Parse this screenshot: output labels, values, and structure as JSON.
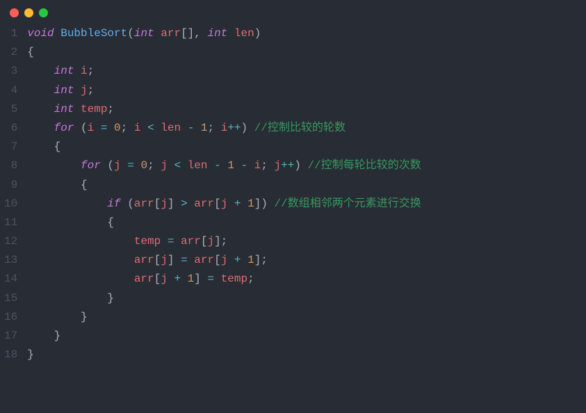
{
  "window": {
    "controls": [
      "red",
      "yellow",
      "green"
    ]
  },
  "code": {
    "line_count": 18,
    "lines": [
      {
        "n": 1,
        "indent": 0,
        "tokens": [
          {
            "t": "void ",
            "c": "type"
          },
          {
            "t": "BubbleSort",
            "c": "fn"
          },
          {
            "t": "(",
            "c": "punc"
          },
          {
            "t": "int ",
            "c": "type"
          },
          {
            "t": "arr",
            "c": "var"
          },
          {
            "t": "[], ",
            "c": "punc"
          },
          {
            "t": "int ",
            "c": "type"
          },
          {
            "t": "len",
            "c": "var"
          },
          {
            "t": ")",
            "c": "punc"
          }
        ]
      },
      {
        "n": 2,
        "indent": 0,
        "tokens": [
          {
            "t": "{",
            "c": "punc"
          }
        ]
      },
      {
        "n": 3,
        "indent": 1,
        "tokens": [
          {
            "t": "int ",
            "c": "type"
          },
          {
            "t": "i",
            "c": "var"
          },
          {
            "t": ";",
            "c": "punc"
          }
        ]
      },
      {
        "n": 4,
        "indent": 1,
        "tokens": [
          {
            "t": "int ",
            "c": "type"
          },
          {
            "t": "j",
            "c": "var"
          },
          {
            "t": ";",
            "c": "punc"
          }
        ]
      },
      {
        "n": 5,
        "indent": 1,
        "tokens": [
          {
            "t": "int ",
            "c": "type"
          },
          {
            "t": "temp",
            "c": "var"
          },
          {
            "t": ";",
            "c": "punc"
          }
        ]
      },
      {
        "n": 6,
        "indent": 1,
        "tokens": [
          {
            "t": "for ",
            "c": "kw"
          },
          {
            "t": "(",
            "c": "punc"
          },
          {
            "t": "i",
            "c": "var"
          },
          {
            "t": " = ",
            "c": "op"
          },
          {
            "t": "0",
            "c": "num"
          },
          {
            "t": "; ",
            "c": "punc"
          },
          {
            "t": "i",
            "c": "var"
          },
          {
            "t": " < ",
            "c": "op"
          },
          {
            "t": "len",
            "c": "var"
          },
          {
            "t": " - ",
            "c": "op"
          },
          {
            "t": "1",
            "c": "num"
          },
          {
            "t": "; ",
            "c": "punc"
          },
          {
            "t": "i",
            "c": "var"
          },
          {
            "t": "++",
            "c": "op"
          },
          {
            "t": ") ",
            "c": "punc"
          },
          {
            "t": "//控制比较的轮数",
            "c": "comment"
          }
        ]
      },
      {
        "n": 7,
        "indent": 1,
        "tokens": [
          {
            "t": "{",
            "c": "punc"
          }
        ]
      },
      {
        "n": 8,
        "indent": 2,
        "tokens": [
          {
            "t": "for ",
            "c": "kw"
          },
          {
            "t": "(",
            "c": "punc"
          },
          {
            "t": "j",
            "c": "var"
          },
          {
            "t": " = ",
            "c": "op"
          },
          {
            "t": "0",
            "c": "num"
          },
          {
            "t": "; ",
            "c": "punc"
          },
          {
            "t": "j",
            "c": "var"
          },
          {
            "t": " < ",
            "c": "op"
          },
          {
            "t": "len",
            "c": "var"
          },
          {
            "t": " - ",
            "c": "op"
          },
          {
            "t": "1",
            "c": "num"
          },
          {
            "t": " - ",
            "c": "op"
          },
          {
            "t": "i",
            "c": "var"
          },
          {
            "t": "; ",
            "c": "punc"
          },
          {
            "t": "j",
            "c": "var"
          },
          {
            "t": "++",
            "c": "op"
          },
          {
            "t": ") ",
            "c": "punc"
          },
          {
            "t": "//控制每轮比较的次数",
            "c": "comment"
          }
        ]
      },
      {
        "n": 9,
        "indent": 2,
        "tokens": [
          {
            "t": "{",
            "c": "punc"
          }
        ]
      },
      {
        "n": 10,
        "indent": 3,
        "tokens": [
          {
            "t": "if ",
            "c": "kw"
          },
          {
            "t": "(",
            "c": "punc"
          },
          {
            "t": "arr",
            "c": "var"
          },
          {
            "t": "[",
            "c": "punc"
          },
          {
            "t": "j",
            "c": "var"
          },
          {
            "t": "] ",
            "c": "punc"
          },
          {
            "t": "> ",
            "c": "op"
          },
          {
            "t": "arr",
            "c": "var"
          },
          {
            "t": "[",
            "c": "punc"
          },
          {
            "t": "j",
            "c": "var"
          },
          {
            "t": " + ",
            "c": "op"
          },
          {
            "t": "1",
            "c": "num"
          },
          {
            "t": "]) ",
            "c": "punc"
          },
          {
            "t": "//数组相邻两个元素进行交换",
            "c": "comment"
          }
        ]
      },
      {
        "n": 11,
        "indent": 3,
        "tokens": [
          {
            "t": "{",
            "c": "punc"
          }
        ]
      },
      {
        "n": 12,
        "indent": 4,
        "tokens": [
          {
            "t": "temp",
            "c": "var"
          },
          {
            "t": " = ",
            "c": "op"
          },
          {
            "t": "arr",
            "c": "var"
          },
          {
            "t": "[",
            "c": "punc"
          },
          {
            "t": "j",
            "c": "var"
          },
          {
            "t": "];",
            "c": "punc"
          }
        ]
      },
      {
        "n": 13,
        "indent": 4,
        "tokens": [
          {
            "t": "arr",
            "c": "var"
          },
          {
            "t": "[",
            "c": "punc"
          },
          {
            "t": "j",
            "c": "var"
          },
          {
            "t": "] ",
            "c": "punc"
          },
          {
            "t": "= ",
            "c": "op"
          },
          {
            "t": "arr",
            "c": "var"
          },
          {
            "t": "[",
            "c": "punc"
          },
          {
            "t": "j",
            "c": "var"
          },
          {
            "t": " + ",
            "c": "op"
          },
          {
            "t": "1",
            "c": "num"
          },
          {
            "t": "];",
            "c": "punc"
          }
        ]
      },
      {
        "n": 14,
        "indent": 4,
        "tokens": [
          {
            "t": "arr",
            "c": "var"
          },
          {
            "t": "[",
            "c": "punc"
          },
          {
            "t": "j",
            "c": "var"
          },
          {
            "t": " + ",
            "c": "op"
          },
          {
            "t": "1",
            "c": "num"
          },
          {
            "t": "] ",
            "c": "punc"
          },
          {
            "t": "= ",
            "c": "op"
          },
          {
            "t": "temp",
            "c": "var"
          },
          {
            "t": ";",
            "c": "punc"
          }
        ]
      },
      {
        "n": 15,
        "indent": 3,
        "tokens": [
          {
            "t": "}",
            "c": "punc"
          }
        ]
      },
      {
        "n": 16,
        "indent": 2,
        "tokens": [
          {
            "t": "}",
            "c": "punc"
          }
        ]
      },
      {
        "n": 17,
        "indent": 1,
        "tokens": [
          {
            "t": "}",
            "c": "punc"
          }
        ]
      },
      {
        "n": 18,
        "indent": 0,
        "tokens": [
          {
            "t": "}",
            "c": "punc"
          }
        ]
      }
    ]
  }
}
